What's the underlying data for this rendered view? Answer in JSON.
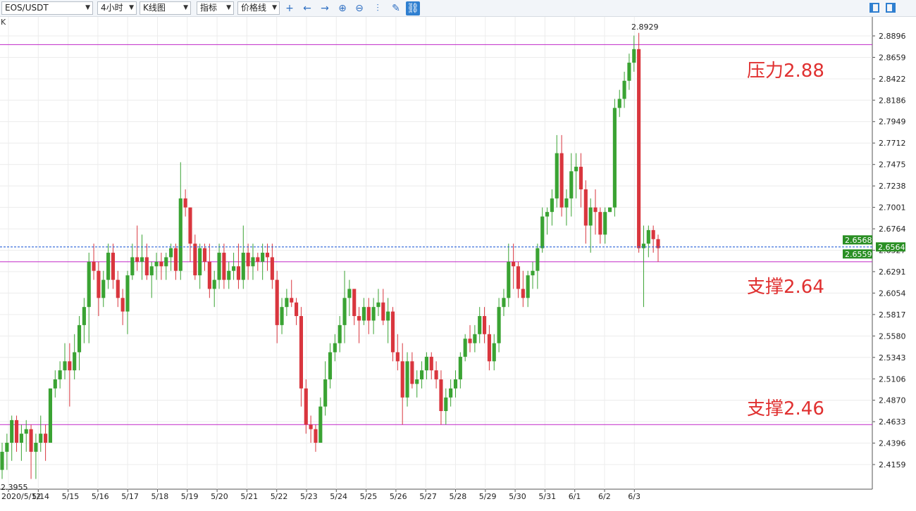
{
  "toolbar": {
    "symbol": "EOS/USDT",
    "period": "4小时",
    "chart_type": "K线图",
    "indicator": "指标",
    "price_line": "价格线",
    "icons": [
      "crosshair-icon",
      "arrow-left-icon",
      "arrow-right-icon",
      "zoom-in-icon",
      "zoom-out-icon",
      "bar-scale-icon",
      "pencil-icon",
      "link-icon",
      "layout-left-icon",
      "layout-right-icon"
    ]
  },
  "k_label": "K",
  "annotations": {
    "resistance": "压力2.88",
    "support1": "支撑2.64",
    "support2": "支撑2.46"
  },
  "colors": {
    "up": "#3aa333",
    "down": "#d9363e",
    "level_line": "#c026c8",
    "current_price_line": "#2a62d8",
    "annotation": "#e03030"
  },
  "chart_data": {
    "type": "candlestick",
    "ylim": [
      2.385,
      2.905
    ],
    "y_ticks": [
      "2.8896",
      "2.8659",
      "2.8422",
      "2.8186",
      "2.7949",
      "2.7712",
      "2.7475",
      "2.7238",
      "2.7001",
      "2.6764",
      "2.6527",
      "2.6291",
      "2.6054",
      "2.5817",
      "2.5580",
      "2.5343",
      "2.5106",
      "2.4870",
      "2.4633",
      "2.4396",
      "2.4159"
    ],
    "x_ticks": [
      "2020/5/12",
      "5/14",
      "5/15",
      "5/16",
      "5/17",
      "5/18",
      "5/19",
      "5/20",
      "5/21",
      "5/22",
      "5/23",
      "5/24",
      "5/25",
      "5/26",
      "5/27",
      "5/28",
      "5/29",
      "5/30",
      "5/31",
      "6/1",
      "6/2",
      "6/3"
    ],
    "high_label": "2.8929",
    "low_label": "2.3955",
    "levels": [
      2.88,
      2.64,
      2.46
    ],
    "current_price": 2.6564,
    "price_tags": [
      "2.6568",
      "2.6564",
      "2.6559"
    ],
    "ohlc": [
      [
        2.41,
        2.44,
        2.4,
        2.43
      ],
      [
        2.43,
        2.45,
        2.41,
        2.44
      ],
      [
        2.44,
        2.47,
        2.42,
        2.465
      ],
      [
        2.465,
        2.47,
        2.43,
        2.44
      ],
      [
        2.44,
        2.46,
        2.42,
        2.45
      ],
      [
        2.45,
        2.465,
        2.43,
        2.455
      ],
      [
        2.455,
        2.46,
        2.4,
        2.43
      ],
      [
        2.43,
        2.45,
        2.4,
        2.44
      ],
      [
        2.44,
        2.47,
        2.43,
        2.45
      ],
      [
        2.45,
        2.46,
        2.42,
        2.44
      ],
      [
        2.44,
        2.5,
        2.44,
        2.5
      ],
      [
        2.5,
        2.52,
        2.49,
        2.51
      ],
      [
        2.51,
        2.53,
        2.5,
        2.52
      ],
      [
        2.52,
        2.55,
        2.51,
        2.53
      ],
      [
        2.53,
        2.55,
        2.48,
        2.52
      ],
      [
        2.52,
        2.56,
        2.51,
        2.54
      ],
      [
        2.54,
        2.58,
        2.52,
        2.57
      ],
      [
        2.57,
        2.6,
        2.55,
        2.59
      ],
      [
        2.59,
        2.65,
        2.55,
        2.64
      ],
      [
        2.64,
        2.66,
        2.62,
        2.63
      ],
      [
        2.63,
        2.64,
        2.58,
        2.6
      ],
      [
        2.6,
        2.63,
        2.59,
        2.62
      ],
      [
        2.62,
        2.66,
        2.61,
        2.65
      ],
      [
        2.65,
        2.66,
        2.61,
        2.62
      ],
      [
        2.62,
        2.63,
        2.59,
        2.6
      ],
      [
        2.6,
        2.61,
        2.57,
        2.585
      ],
      [
        2.585,
        2.63,
        2.56,
        2.625
      ],
      [
        2.625,
        2.66,
        2.62,
        2.645
      ],
      [
        2.645,
        2.68,
        2.63,
        2.64
      ],
      [
        2.64,
        2.67,
        2.62,
        2.645
      ],
      [
        2.645,
        2.66,
        2.62,
        2.625
      ],
      [
        2.625,
        2.64,
        2.6,
        2.635
      ],
      [
        2.635,
        2.65,
        2.62,
        2.64
      ],
      [
        2.64,
        2.65,
        2.62,
        2.635
      ],
      [
        2.635,
        2.65,
        2.62,
        2.645
      ],
      [
        2.645,
        2.66,
        2.63,
        2.655
      ],
      [
        2.655,
        2.66,
        2.62,
        2.63
      ],
      [
        2.63,
        2.75,
        2.62,
        2.71
      ],
      [
        2.71,
        2.72,
        2.69,
        2.7
      ],
      [
        2.7,
        2.7,
        2.64,
        2.66
      ],
      [
        2.66,
        2.67,
        2.62,
        2.625
      ],
      [
        2.625,
        2.66,
        2.61,
        2.655
      ],
      [
        2.655,
        2.66,
        2.63,
        2.64
      ],
      [
        2.64,
        2.66,
        2.6,
        2.61
      ],
      [
        2.61,
        2.63,
        2.59,
        2.62
      ],
      [
        2.62,
        2.66,
        2.61,
        2.65
      ],
      [
        2.65,
        2.66,
        2.61,
        2.62
      ],
      [
        2.62,
        2.64,
        2.61,
        2.63
      ],
      [
        2.63,
        2.65,
        2.62,
        2.635
      ],
      [
        2.635,
        2.66,
        2.61,
        2.62
      ],
      [
        2.62,
        2.68,
        2.61,
        2.65
      ],
      [
        2.65,
        2.66,
        2.62,
        2.635
      ],
      [
        2.635,
        2.66,
        2.62,
        2.645
      ],
      [
        2.645,
        2.65,
        2.63,
        2.64
      ],
      [
        2.64,
        2.66,
        2.62,
        2.65
      ],
      [
        2.65,
        2.66,
        2.63,
        2.645
      ],
      [
        2.645,
        2.66,
        2.61,
        2.62
      ],
      [
        2.62,
        2.63,
        2.55,
        2.57
      ],
      [
        2.57,
        2.6,
        2.56,
        2.59
      ],
      [
        2.59,
        2.61,
        2.58,
        2.6
      ],
      [
        2.6,
        2.62,
        2.59,
        2.595
      ],
      [
        2.595,
        2.6,
        2.57,
        2.58
      ],
      [
        2.58,
        2.59,
        2.48,
        2.5
      ],
      [
        2.5,
        2.51,
        2.45,
        2.46
      ],
      [
        2.46,
        2.47,
        2.44,
        2.455
      ],
      [
        2.455,
        2.46,
        2.43,
        2.44
      ],
      [
        2.44,
        2.49,
        2.44,
        2.48
      ],
      [
        2.48,
        2.53,
        2.47,
        2.51
      ],
      [
        2.51,
        2.55,
        2.5,
        2.54
      ],
      [
        2.54,
        2.56,
        2.53,
        2.55
      ],
      [
        2.55,
        2.58,
        2.54,
        2.57
      ],
      [
        2.57,
        2.63,
        2.55,
        2.6
      ],
      [
        2.6,
        2.62,
        2.58,
        2.61
      ],
      [
        2.61,
        2.61,
        2.57,
        2.58
      ],
      [
        2.58,
        2.59,
        2.55,
        2.575
      ],
      [
        2.575,
        2.6,
        2.57,
        2.59
      ],
      [
        2.59,
        2.6,
        2.56,
        2.575
      ],
      [
        2.575,
        2.6,
        2.56,
        2.59
      ],
      [
        2.59,
        2.61,
        2.58,
        2.595
      ],
      [
        2.595,
        2.61,
        2.57,
        2.575
      ],
      [
        2.575,
        2.6,
        2.55,
        2.585
      ],
      [
        2.585,
        2.59,
        2.53,
        2.54
      ],
      [
        2.54,
        2.56,
        2.52,
        2.53
      ],
      [
        2.53,
        2.55,
        2.46,
        2.49
      ],
      [
        2.49,
        2.54,
        2.48,
        2.53
      ],
      [
        2.53,
        2.54,
        2.5,
        2.505
      ],
      [
        2.505,
        2.52,
        2.49,
        2.51
      ],
      [
        2.51,
        2.53,
        2.5,
        2.52
      ],
      [
        2.52,
        2.54,
        2.51,
        2.535
      ],
      [
        2.535,
        2.54,
        2.51,
        2.52
      ],
      [
        2.52,
        2.53,
        2.5,
        2.51
      ],
      [
        2.51,
        2.52,
        2.46,
        2.475
      ],
      [
        2.475,
        2.5,
        2.46,
        2.49
      ],
      [
        2.49,
        2.51,
        2.48,
        2.5
      ],
      [
        2.5,
        2.52,
        2.49,
        2.51
      ],
      [
        2.51,
        2.54,
        2.5,
        2.535
      ],
      [
        2.535,
        2.56,
        2.53,
        2.555
      ],
      [
        2.555,
        2.57,
        2.54,
        2.55
      ],
      [
        2.55,
        2.57,
        2.54,
        2.56
      ],
      [
        2.56,
        2.59,
        2.55,
        2.58
      ],
      [
        2.58,
        2.59,
        2.55,
        2.56
      ],
      [
        2.56,
        2.57,
        2.52,
        2.53
      ],
      [
        2.53,
        2.56,
        2.52,
        2.55
      ],
      [
        2.55,
        2.6,
        2.54,
        2.59
      ],
      [
        2.59,
        2.61,
        2.58,
        2.6
      ],
      [
        2.6,
        2.66,
        2.59,
        2.64
      ],
      [
        2.64,
        2.66,
        2.61,
        2.635
      ],
      [
        2.635,
        2.64,
        2.6,
        2.61
      ],
      [
        2.61,
        2.63,
        2.59,
        2.6
      ],
      [
        2.6,
        2.63,
        2.59,
        2.625
      ],
      [
        2.625,
        2.64,
        2.61,
        2.63
      ],
      [
        2.63,
        2.66,
        2.61,
        2.655
      ],
      [
        2.655,
        2.7,
        2.65,
        2.69
      ],
      [
        2.69,
        2.7,
        2.67,
        2.695
      ],
      [
        2.695,
        2.72,
        2.68,
        2.71
      ],
      [
        2.71,
        2.78,
        2.7,
        2.76
      ],
      [
        2.76,
        2.78,
        2.69,
        2.7
      ],
      [
        2.7,
        2.72,
        2.68,
        2.71
      ],
      [
        2.71,
        2.76,
        2.69,
        2.74
      ],
      [
        2.74,
        2.76,
        2.71,
        2.745
      ],
      [
        2.745,
        2.76,
        2.7,
        2.72
      ],
      [
        2.72,
        2.73,
        2.66,
        2.68
      ],
      [
        2.68,
        2.71,
        2.65,
        2.7
      ],
      [
        2.7,
        2.72,
        2.67,
        2.695
      ],
      [
        2.695,
        2.7,
        2.66,
        2.67
      ],
      [
        2.67,
        2.7,
        2.66,
        2.695
      ],
      [
        2.695,
        2.7,
        2.695,
        2.7
      ],
      [
        2.7,
        2.82,
        2.69,
        2.81
      ],
      [
        2.81,
        2.83,
        2.8,
        2.82
      ],
      [
        2.82,
        2.85,
        2.81,
        2.84
      ],
      [
        2.84,
        2.87,
        2.83,
        2.86
      ],
      [
        2.86,
        2.89,
        2.85,
        2.875
      ],
      [
        2.875,
        2.8929,
        2.65,
        2.655
      ],
      [
        2.655,
        2.68,
        2.59,
        2.66
      ],
      [
        2.66,
        2.68,
        2.645,
        2.675
      ],
      [
        2.675,
        2.68,
        2.65,
        2.665
      ],
      [
        2.665,
        2.67,
        2.64,
        2.655
      ]
    ]
  }
}
